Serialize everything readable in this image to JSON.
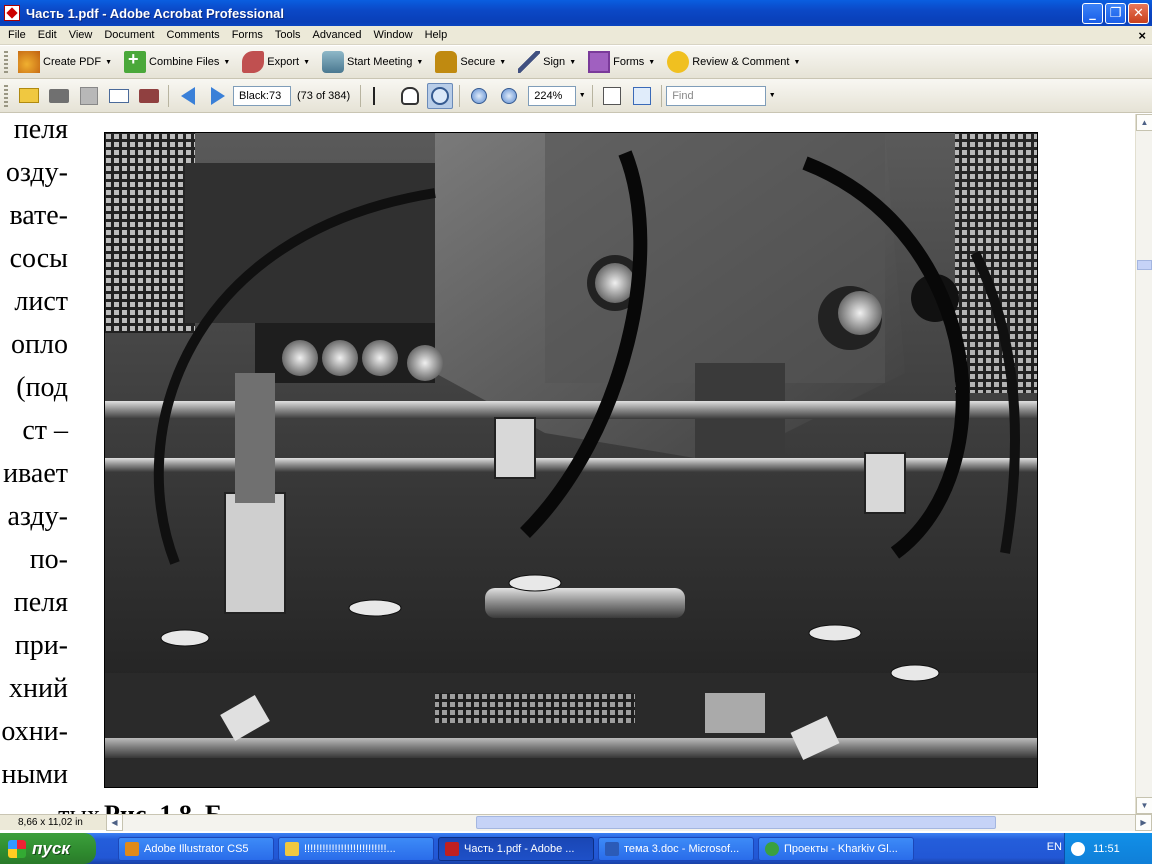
{
  "window": {
    "title": "Часть 1.pdf - Adobe Acrobat Professional",
    "min_icon": "minimize-icon",
    "max_icon": "restore-icon",
    "close_icon": "close-icon",
    "min_glyph": "_",
    "max_glyph": "❐",
    "close_glyph": "✕"
  },
  "menu": {
    "items": [
      "File",
      "Edit",
      "View",
      "Document",
      "Comments",
      "Forms",
      "Tools",
      "Advanced",
      "Window",
      "Help"
    ],
    "close_glyph": "×"
  },
  "toolbar1": {
    "buttons": [
      {
        "label": "Create PDF",
        "icon": "create-pdf-icon"
      },
      {
        "label": "Combine Files",
        "icon": "combine-files-icon"
      },
      {
        "label": "Export",
        "icon": "export-icon"
      },
      {
        "label": "Start Meeting",
        "icon": "meeting-icon"
      },
      {
        "label": "Secure",
        "icon": "lock-icon"
      },
      {
        "label": "Sign",
        "icon": "pen-icon"
      },
      {
        "label": "Forms",
        "icon": "forms-icon"
      },
      {
        "label": "Review & Comment",
        "icon": "comment-icon"
      }
    ],
    "dropdown_glyph": "▼"
  },
  "toolbar2": {
    "page_field": "Black:73",
    "page_count": "(73 of 384)",
    "zoom": "224%",
    "find_placeholder": "Find",
    "dropdown_glyph": "▼"
  },
  "document": {
    "left_text_lines": [
      "пеля",
      "озду-",
      "вате-",
      "сосы",
      "лист",
      "опло",
      "(под",
      "ст –",
      "ивает",
      "азду-",
      "по-",
      "пеля",
      "при-",
      "хний",
      "охни-",
      "ными"
    ],
    "bottom_partial_left": "тых",
    "caption_partial": "Рис. 1.8. Б"
  },
  "status": {
    "page_size": "8,66 x 11,02 in"
  },
  "taskbar": {
    "start_label": "пуск",
    "tasks": [
      {
        "label": "Adobe Illustrator CS5",
        "color": "#e08a1a"
      },
      {
        "label": "!!!!!!!!!!!!!!!!!!!!!!!!!!!...",
        "color": "#f0c840"
      },
      {
        "label": "Часть 1.pdf - Adobe ...",
        "color": "#c02020"
      },
      {
        "label": "тема 3.doc - Microsof...",
        "color": "#2b5bb8"
      },
      {
        "label": "Проекты - Kharkiv Gl...",
        "color": "#3aa040"
      }
    ],
    "lang": "EN",
    "time": "11:51"
  }
}
